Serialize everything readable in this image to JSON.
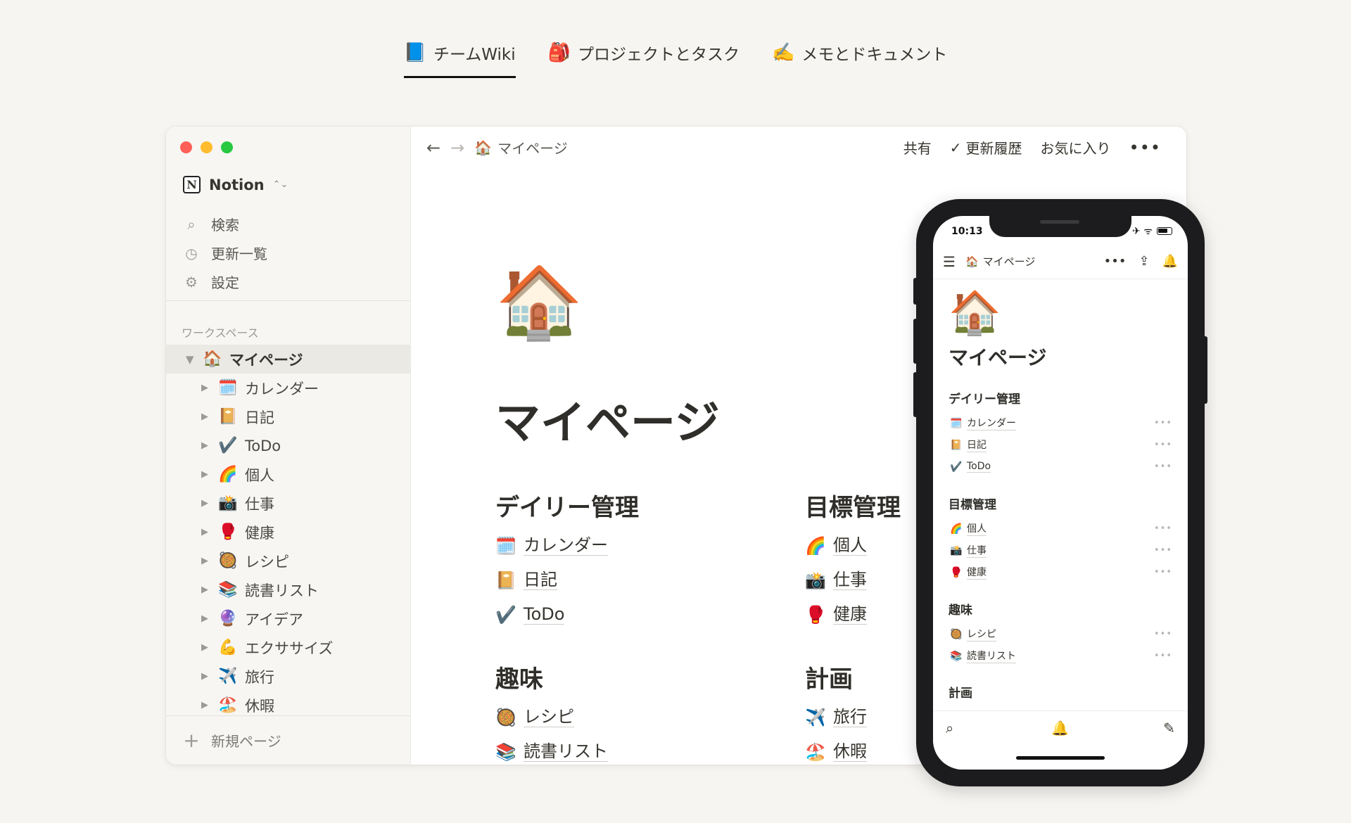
{
  "top_tabs": [
    {
      "emoji": "📘",
      "label": "チームWiki",
      "active": true
    },
    {
      "emoji": "🎒",
      "label": "プロジェクトとタスク",
      "active": false
    },
    {
      "emoji": "✍️",
      "label": "メモとドキュメント",
      "active": false
    }
  ],
  "sidebar": {
    "workspace_name": "Notion",
    "workspace_logo": "N",
    "switcher_icon": "⌃⌄",
    "menu": [
      {
        "icon": "search-icon",
        "glyph": "⌕",
        "label": "検索"
      },
      {
        "icon": "clock-icon",
        "glyph": "◷",
        "label": "更新一覧"
      },
      {
        "icon": "gear-icon",
        "glyph": "⚙",
        "label": "設定"
      }
    ],
    "workspace_label": "ワークスペース",
    "root": {
      "arrow": "▼",
      "emoji": "🏠",
      "label": "マイページ"
    },
    "children": [
      {
        "arrow": "▶",
        "emoji": "🗓️",
        "label": "カレンダー"
      },
      {
        "arrow": "▶",
        "emoji": "📔",
        "label": "日記"
      },
      {
        "arrow": "▶",
        "emoji": "✔️",
        "label": "ToDo"
      },
      {
        "arrow": "▶",
        "emoji": "🌈",
        "label": "個人"
      },
      {
        "arrow": "▶",
        "emoji": "📸",
        "label": "仕事"
      },
      {
        "arrow": "▶",
        "emoji": "🥊",
        "label": "健康"
      },
      {
        "arrow": "▶",
        "emoji": "🥘",
        "label": "レシピ"
      },
      {
        "arrow": "▶",
        "emoji": "📚",
        "label": "読書リスト"
      },
      {
        "arrow": "▶",
        "emoji": "🔮",
        "label": "アイデア"
      },
      {
        "arrow": "▶",
        "emoji": "💪",
        "label": "エクササイズ"
      },
      {
        "arrow": "▶",
        "emoji": "✈️",
        "label": "旅行"
      },
      {
        "arrow": "▶",
        "emoji": "🏖️",
        "label": "休暇"
      }
    ],
    "new_page": {
      "icon": "+",
      "label": "新規ページ"
    }
  },
  "topbar": {
    "back": "←",
    "forward": "→",
    "page_emoji": "🏠",
    "page_label": "マイページ",
    "share": "共有",
    "history_check": "✓",
    "history": "更新履歴",
    "favorite": "お気に入り",
    "more": "•••"
  },
  "page": {
    "icon": "🏠",
    "title": "マイページ",
    "sections": [
      {
        "heading": "デイリー管理",
        "items": [
          {
            "emoji": "🗓️",
            "label": "カレンダー"
          },
          {
            "emoji": "📔",
            "label": "日記"
          },
          {
            "emoji": "✔️",
            "label": "ToDo"
          }
        ]
      },
      {
        "heading": "目標管理",
        "items": [
          {
            "emoji": "🌈",
            "label": "個人"
          },
          {
            "emoji": "📸",
            "label": "仕事"
          },
          {
            "emoji": "🥊",
            "label": "健康"
          }
        ]
      },
      {
        "heading": "趣味",
        "items": [
          {
            "emoji": "🥘",
            "label": "レシピ"
          },
          {
            "emoji": "📚",
            "label": "読書リスト"
          }
        ]
      },
      {
        "heading": "計画",
        "items": [
          {
            "emoji": "✈️",
            "label": "旅行"
          },
          {
            "emoji": "🏖️",
            "label": "休暇"
          }
        ]
      }
    ]
  },
  "phone": {
    "time": "10:13",
    "status_icons": "✈ ᯤ",
    "nav": {
      "menu": "☰",
      "emoji": "🏠",
      "title": "マイページ",
      "more": "•••",
      "share": "⇪",
      "bell": "🔔"
    },
    "page_icon": "🏠",
    "page_title": "マイページ",
    "sections": [
      {
        "heading": "デイリー管理",
        "items": [
          {
            "emoji": "🗓️",
            "label": "カレンダー"
          },
          {
            "emoji": "📔",
            "label": "日記"
          },
          {
            "emoji": "✔️",
            "label": "ToDo"
          }
        ]
      },
      {
        "heading": "目標管理",
        "items": [
          {
            "emoji": "🌈",
            "label": "個人"
          },
          {
            "emoji": "📸",
            "label": "仕事"
          },
          {
            "emoji": "🥊",
            "label": "健康"
          }
        ]
      },
      {
        "heading": "趣味",
        "items": [
          {
            "emoji": "🥘",
            "label": "レシピ"
          },
          {
            "emoji": "📚",
            "label": "読書リスト"
          }
        ]
      },
      {
        "heading": "計画",
        "items": []
      }
    ],
    "row_more": "•••",
    "bottom": {
      "search": "⌕",
      "bell": "🔔",
      "compose": "✎"
    }
  }
}
